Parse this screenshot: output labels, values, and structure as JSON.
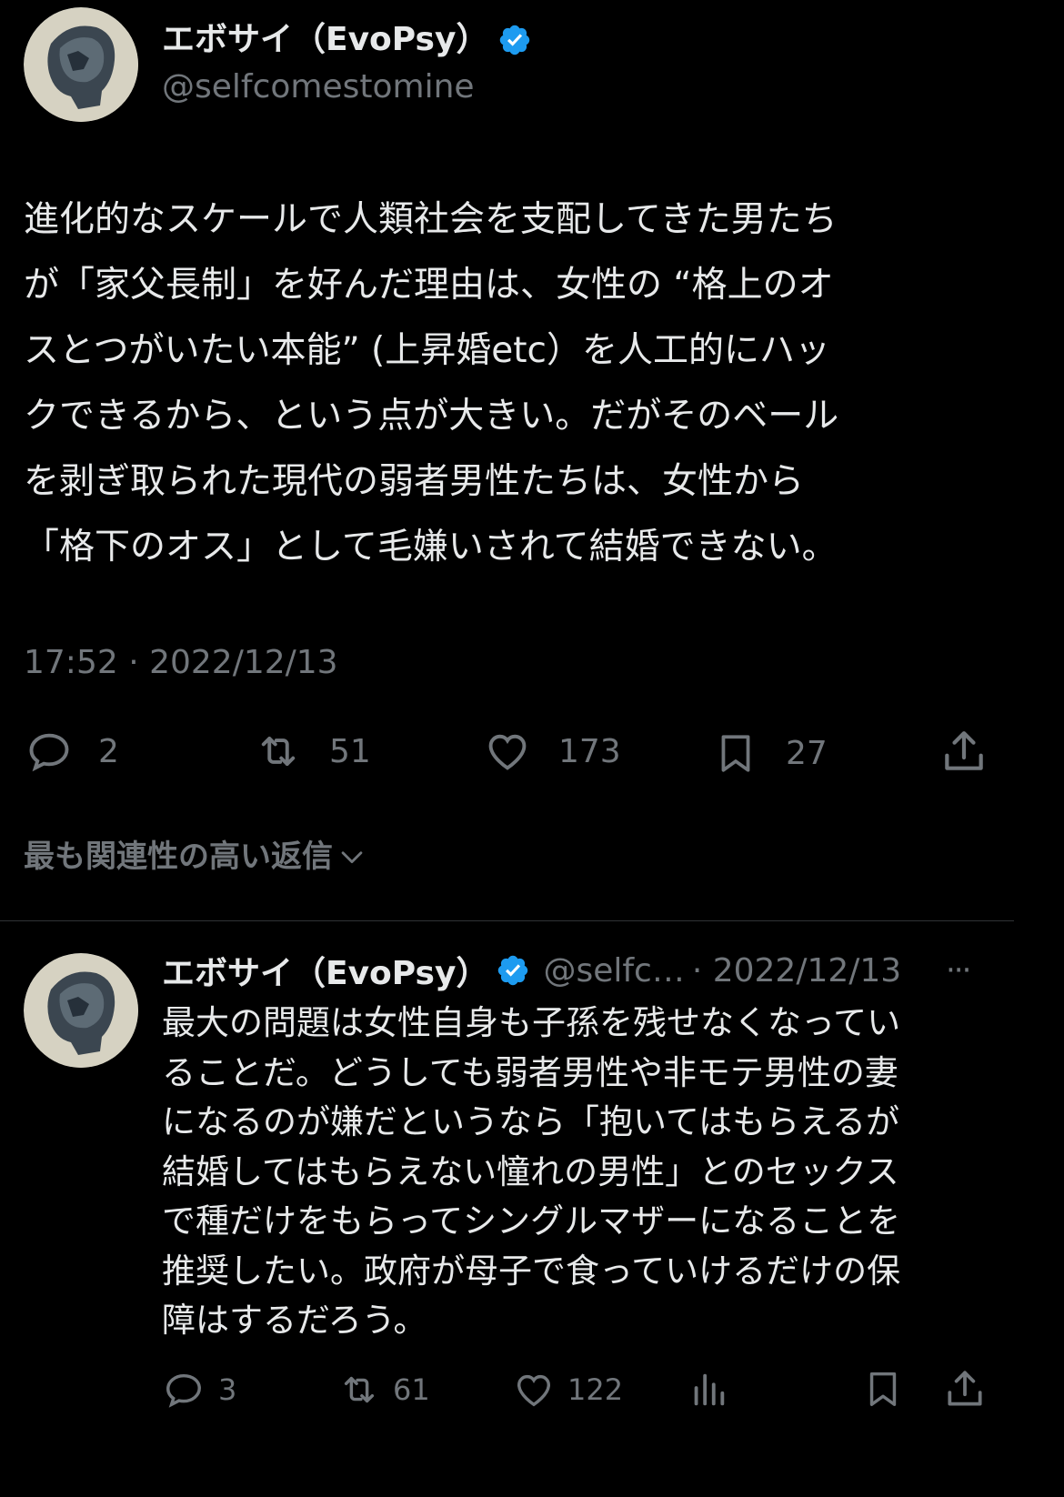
{
  "main_tweet": {
    "author_name": "エボサイ（EvoPsy）",
    "handle": "@selfcomestomine",
    "lines": [
      "進化的なスケールで人類社会を支配してきた男たち",
      "が「家父長制」を好んだ理由は、女性の “格上のオ",
      "スとつがいたい本能” (上昇婚etc）を人工的にハッ",
      "クできるから、という点が大きい。だがそのベール",
      "を剥ぎ取られた現代の弱者男性たちは、女性から",
      "「格下のオス」として毛嫌いされて結婚できない。"
    ],
    "timestamp": "17:52 · 2022/12/13",
    "stats": {
      "replies": "2",
      "retweets": "51",
      "likes": "173",
      "bookmarks": "27"
    }
  },
  "reply_sort_label": "最も関連性の高い返信",
  "reply": {
    "author_name": "エボサイ（EvoPsy）",
    "handle_truncated": "@selfc…",
    "date": "· 2022/12/13",
    "more": "···",
    "lines": [
      "最大の問題は女性自身も子孫を残せなくなってい",
      "ることだ。どうしても弱者男性や非モテ男性の妻",
      "になるのが嫌だというなら「抱いてはもらえるが",
      "結婚してはもらえない憧れの男性」とのセックス",
      "で種だけをもらってシングルマザーになることを",
      "推奨したい。政府が母子で食っていけるだけの保",
      "障はするだろう。"
    ],
    "stats": {
      "replies": "3",
      "retweets": "61",
      "likes": "122"
    }
  },
  "colors": {
    "background": "#000000",
    "text": "#e7e9ea",
    "muted": "#71767b",
    "verified": "#1d9bf0",
    "divider": "#2f3336"
  }
}
